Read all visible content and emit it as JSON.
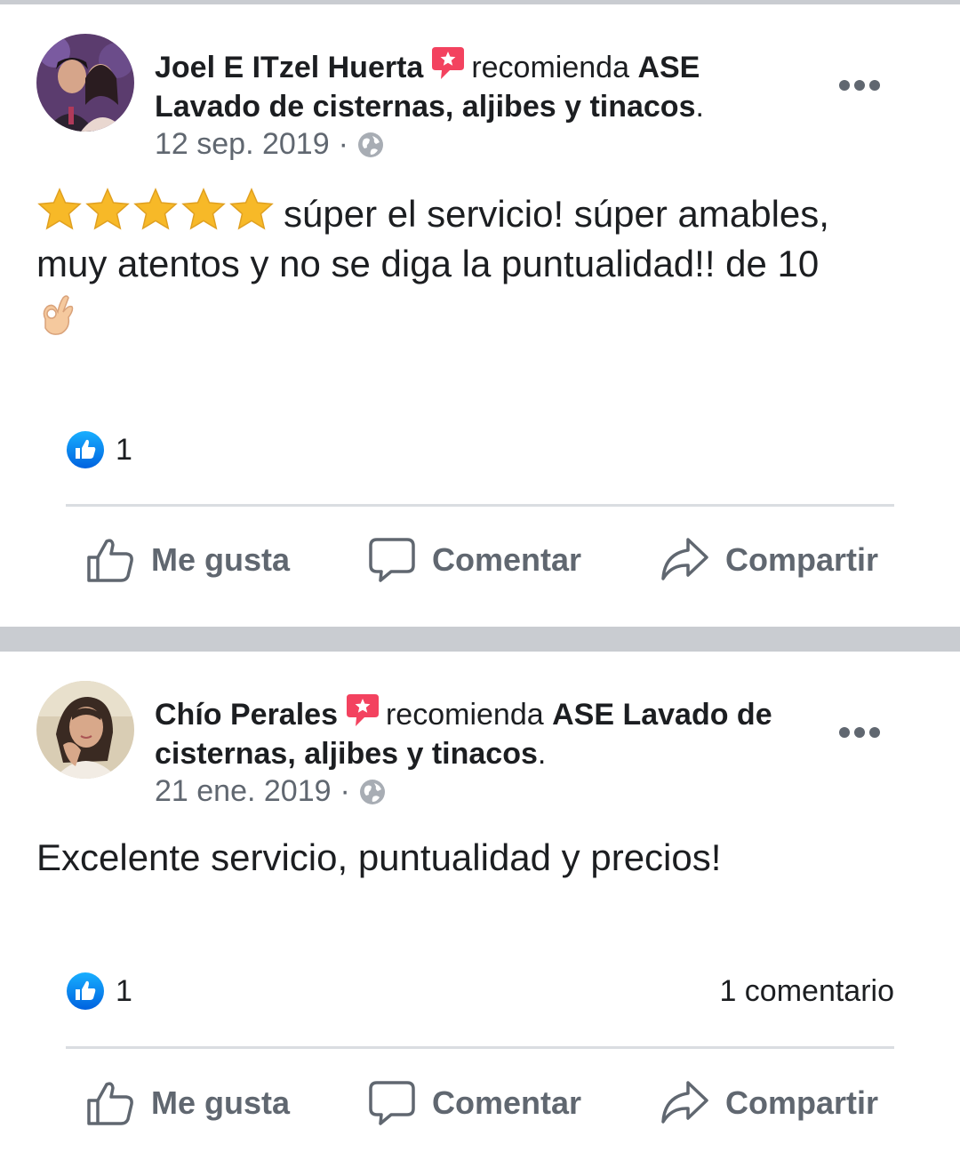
{
  "posts": [
    {
      "author": "Joel E ITzel Huerta",
      "recommends_word": "recomienda",
      "page_name": "ASE Lavado de cisternas, aljibes y tinacos",
      "period": ".",
      "date": "12 sep. 2019",
      "separator": "·",
      "rating_stars": 5,
      "text": "súper el servicio! súper amables, muy atentos y no se diga la puntualidad!! de 10",
      "likes": "1",
      "comments": "",
      "actions": {
        "like": "Me gusta",
        "comment": "Comentar",
        "share": "Compartir"
      }
    },
    {
      "author": "Chío Perales",
      "recommends_word": "recomienda",
      "page_name": "ASE Lavado de cisternas, aljibes y tinacos",
      "period": ".",
      "date": "21 ene. 2019",
      "separator": "·",
      "text": "Excelente servicio, puntualidad y precios!",
      "likes": "1",
      "comments": "1 comentario",
      "actions": {
        "like": "Me gusta",
        "comment": "Comentar",
        "share": "Compartir"
      }
    }
  ],
  "colors": {
    "text": "#1c1e21",
    "secondary": "#606770",
    "like_blue": "#1877f2",
    "recommend_red": "#f3425f",
    "divider": "#c9ccd1",
    "star": "#f7b928"
  }
}
